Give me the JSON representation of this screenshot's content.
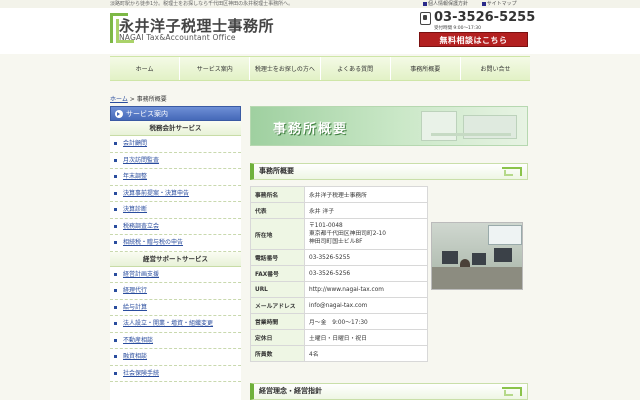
{
  "top": {
    "tagline": "淡路町駅から徒歩1分。税理士をお探しなら千代田区神田の永井税理士事務所へ。",
    "links": [
      "個人情報保護方針",
      "サイトマップ"
    ]
  },
  "header": {
    "title": "永井洋子税理士事務所",
    "subtitle": "NAGAI Tax&Accountant Office",
    "tel": "03-3526-5255",
    "hours": "受付時間 9:00〜17:30",
    "consult_button": "無料相談はこちら"
  },
  "nav": [
    "ホーム",
    "サービス案内",
    "税理士をお探しの方へ",
    "よくある質問",
    "事務所概要",
    "お問い合せ"
  ],
  "breadcrumb": {
    "home": "ホーム",
    "sep": ">",
    "current": "事務所概要"
  },
  "sidebar": {
    "heading": "サービス案内",
    "cat1": "税務会計サービス",
    "cat1_items": [
      "会計顧問",
      "月次訪問監査",
      "年末調整",
      "決算事前提案・決算申告",
      "決算診断",
      "税務調査立会",
      "相続税・贈与税の申告"
    ],
    "cat2": "経営サポートサービス",
    "cat2_items": [
      "経営計画支援",
      "経理代行",
      "給与計算",
      "法人設立・開業・増資・組織変更",
      "不動産相談",
      "融資相談",
      "社会保険手続"
    ]
  },
  "main": {
    "banner_title": "事務所概要",
    "section1": "事務所概要",
    "section2": "経営理念・経営指針",
    "table": [
      {
        "k": "事務所名",
        "v": "永井洋子税理士事務所"
      },
      {
        "k": "代表",
        "v": "永井 洋子"
      },
      {
        "k": "所在地",
        "v": "〒101-0048\n東京都千代田区神田司町2-10\n神田司町国士ビル8F"
      },
      {
        "k": "電話番号",
        "v": "03-3526-5255"
      },
      {
        "k": "FAX番号",
        "v": "03-3526-5256"
      },
      {
        "k": "URL",
        "v": "http://www.nagai-tax.com"
      },
      {
        "k": "メールアドレス",
        "v": "info@nagai-tax.com"
      },
      {
        "k": "営業時間",
        "v": "月〜金　9:00〜17:30"
      },
      {
        "k": "定休日",
        "v": "土曜日・日曜日・祝日"
      },
      {
        "k": "所員数",
        "v": "4名"
      }
    ]
  }
}
